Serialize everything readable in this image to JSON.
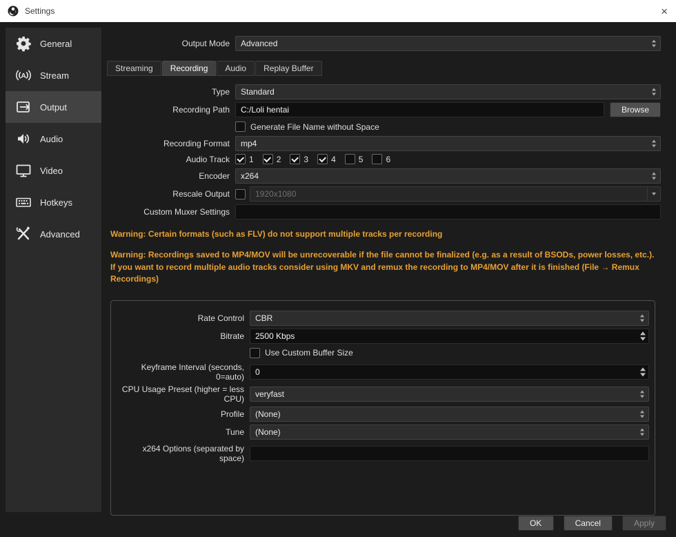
{
  "window": {
    "title": "Settings",
    "close_glyph": "×"
  },
  "colors": {
    "warning_text": "#e8a033",
    "sidebar_bg": "#2b2b2b",
    "titlebar_bg": "#ffffff"
  },
  "sidebar": {
    "items": [
      {
        "label": "General",
        "icon": "gear-icon",
        "selected": false
      },
      {
        "label": "Stream",
        "icon": "stream-icon",
        "selected": false
      },
      {
        "label": "Output",
        "icon": "output-icon",
        "selected": true
      },
      {
        "label": "Audio",
        "icon": "speaker-icon",
        "selected": false
      },
      {
        "label": "Video",
        "icon": "monitor-icon",
        "selected": false
      },
      {
        "label": "Hotkeys",
        "icon": "keyboard-icon",
        "selected": false
      },
      {
        "label": "Advanced",
        "icon": "tools-icon",
        "selected": false
      }
    ]
  },
  "output_mode": {
    "label": "Output Mode",
    "value": "Advanced"
  },
  "tabs": [
    {
      "label": "Streaming",
      "active": false
    },
    {
      "label": "Recording",
      "active": true
    },
    {
      "label": "Audio",
      "active": false
    },
    {
      "label": "Replay Buffer",
      "active": false
    }
  ],
  "recording": {
    "type": {
      "label": "Type",
      "value": "Standard"
    },
    "path": {
      "label": "Recording Path",
      "value": "C:/Loli hentai",
      "browse_label": "Browse"
    },
    "generate_no_space": {
      "label": "Generate File Name without Space",
      "checked": false
    },
    "format": {
      "label": "Recording Format",
      "value": "mp4"
    },
    "audio_track": {
      "label": "Audio Track",
      "tracks": [
        {
          "label": "1",
          "checked": true
        },
        {
          "label": "2",
          "checked": true
        },
        {
          "label": "3",
          "checked": true
        },
        {
          "label": "4",
          "checked": true
        },
        {
          "label": "5",
          "checked": false
        },
        {
          "label": "6",
          "checked": false
        }
      ]
    },
    "encoder": {
      "label": "Encoder",
      "value": "x264"
    },
    "rescale": {
      "label": "Rescale Output",
      "checked": false,
      "value": "1920x1080",
      "disabled": true
    },
    "custom_muxer": {
      "label": "Custom Muxer Settings",
      "value": ""
    },
    "warnings": [
      "Warning: Certain formats (such as FLV) do not support multiple tracks per recording",
      "Warning: Recordings saved to MP4/MOV will be unrecoverable if the file cannot be finalized (e.g. as a result of BSODs, power losses, etc.). If you want to record multiple audio tracks consider using MKV and remux the recording to MP4/MOV after it is finished (File → Remux Recordings)"
    ]
  },
  "encoder_settings": {
    "rate_control": {
      "label": "Rate Control",
      "value": "CBR"
    },
    "bitrate": {
      "label": "Bitrate",
      "value": "2500 Kbps"
    },
    "custom_buffer": {
      "label": "Use Custom Buffer Size",
      "checked": false
    },
    "keyframe_interval": {
      "label": "Keyframe Interval (seconds, 0=auto)",
      "value": "0"
    },
    "cpu_preset": {
      "label": "CPU Usage Preset (higher = less CPU)",
      "value": "veryfast"
    },
    "profile": {
      "label": "Profile",
      "value": "(None)"
    },
    "tune": {
      "label": "Tune",
      "value": "(None)"
    },
    "x264_options": {
      "label": "x264 Options (separated by space)",
      "value": ""
    }
  },
  "footer": {
    "ok": "OK",
    "cancel": "Cancel",
    "apply": "Apply",
    "apply_disabled": true
  }
}
